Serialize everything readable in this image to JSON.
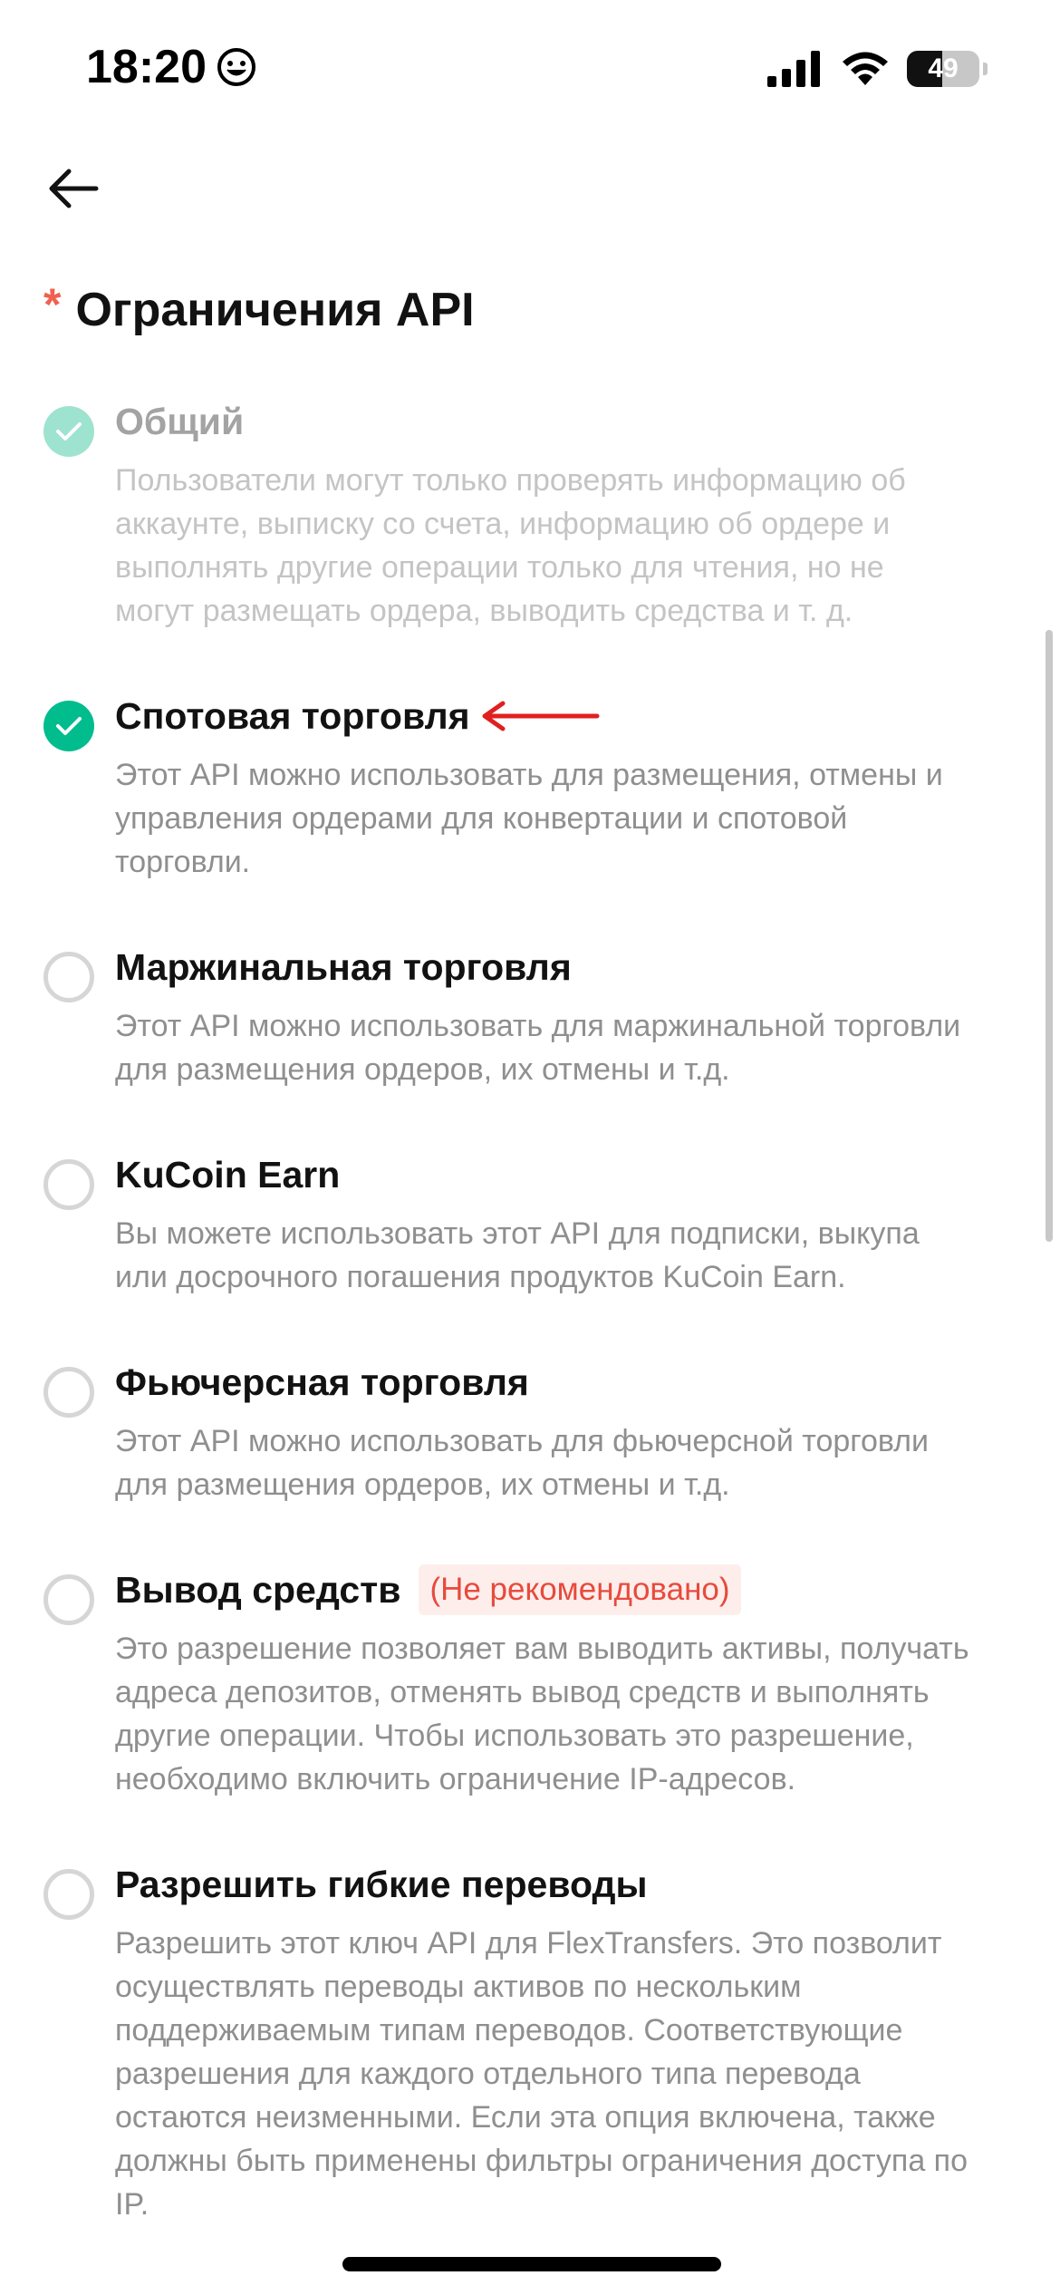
{
  "status_bar": {
    "time": "18:20",
    "time_icon": "smiley-icon",
    "battery_level": "49",
    "battery_fraction": 0.49,
    "icons": [
      "signal-icon",
      "wifi-icon",
      "battery-icon"
    ]
  },
  "nav": {
    "back_icon": "arrow-left-icon"
  },
  "section": {
    "required_mark": "*",
    "title": "Ограничения API"
  },
  "permissions": [
    {
      "title": "Общий",
      "state": "checked-disabled",
      "description": "Пользователи могут только проверять информацию об аккаунте, выписку со счета, информацию об ордере и выполнять другие операции только для чтения, но не могут размещать ордера, выводить средства и т. д."
    },
    {
      "title": "Спотовая торговля",
      "state": "checked",
      "annotation": "red-arrow-icon",
      "description": "Этот API можно использовать для размещения, отмены и управления ордерами для конвертации и спотовой торговли."
    },
    {
      "title": "Маржинальная торговля",
      "state": "unchecked",
      "description": "Этот API можно использовать для маржинальной торговли для размещения ордеров, их отмены и т.д."
    },
    {
      "title": "KuCoin Earn",
      "state": "unchecked",
      "description": "Вы можете использовать этот API для подписки, выкупа или досрочного погашения продуктов KuCoin Earn."
    },
    {
      "title": "Фьючерсная торговля",
      "state": "unchecked",
      "description": "Этот API можно использовать для фьючерсной торговли для размещения ордеров, их отмены и т.д."
    },
    {
      "title": "Вывод средств",
      "state": "unchecked",
      "badge": "(Не рекомендовано)",
      "description": "Это разрешение позволяет вам выводить активы, получать адреса депозитов, отменять вывод средств и выполнять другие операции. Чтобы использовать это разрешение, необходимо включить ограничение IP-адресов."
    },
    {
      "title": "Разрешить гибкие переводы",
      "state": "unchecked",
      "description": "Разрешить этот ключ API для FlexTransfers. Это позволит осуществлять переводы активов по нескольким поддерживаемым типам переводов. Соответствующие разрешения для каждого отдельного типа перевода остаются неизменными. Если эта опция включена, также должны быть применены фильтры ограничения доступа по IP."
    }
  ],
  "colors": {
    "accent_green": "#01bc8d",
    "accent_green_disabled": "#9ee3cf",
    "required_red": "#f0614f",
    "badge_red": "#e84a3c",
    "badge_bg": "#fdeeec",
    "annotation_red": "#e02020"
  }
}
